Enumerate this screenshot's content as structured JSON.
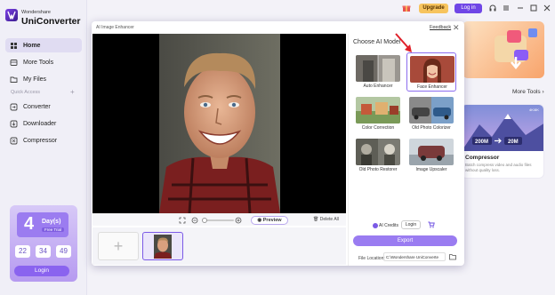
{
  "app": {
    "brand_small": "Wondershare",
    "brand_big": "UniConverter"
  },
  "sidebar": {
    "items": [
      {
        "label": "Home",
        "icon": "home-icon"
      },
      {
        "label": "More Tools",
        "icon": "grid-icon"
      },
      {
        "label": "My Files",
        "icon": "folder-icon"
      },
      {
        "label": "Converter",
        "icon": "convert-icon"
      },
      {
        "label": "Downloader",
        "icon": "download-icon"
      },
      {
        "label": "Compressor",
        "icon": "compress-icon"
      }
    ],
    "quick_access": "Quick Access",
    "quick_plus": "+"
  },
  "promo": {
    "days_num": "4",
    "days_text": "Day(s)",
    "trial": "Free Trial",
    "countdown": [
      "22",
      "34",
      "49"
    ],
    "login": "Login"
  },
  "topbar": {
    "upgrade": "Upgrade",
    "login": "Log in"
  },
  "background": {
    "more_tools": "More Tools",
    "card2_title": "Compressor",
    "card2_desc": "Batch compress video and audio files without quality loss.",
    "card2_size_a": "200M",
    "card2_size_b": "20M",
    "card2_tag": "4K/8K"
  },
  "dialog": {
    "title": "AI Image Enhancer",
    "feedback": "Feedback",
    "close": "✕",
    "preview_btn": "Preview",
    "delete_all": "Delete All",
    "add_symbol": "+"
  },
  "right_panel": {
    "title": "Choose AI Model",
    "models": [
      {
        "label": "Auto Enhancer",
        "selected": false
      },
      {
        "label": "Face Enhancer",
        "selected": true
      },
      {
        "label": "Color Correction",
        "selected": false
      },
      {
        "label": "Old Photo Colorizer",
        "selected": false
      },
      {
        "label": "Old Photo Restorer",
        "selected": false
      },
      {
        "label": "Image Upscaler",
        "selected": false
      }
    ],
    "ai_credits": "AI Credits",
    "login": "Login",
    "export": "Export",
    "file_location_label": "File Location:",
    "file_location_value": "C:\\Wondershare UniConverte"
  },
  "colors": {
    "accent": "#7b5ae6",
    "upgrade": "#f7c45e",
    "arrow": "#e0202a"
  }
}
